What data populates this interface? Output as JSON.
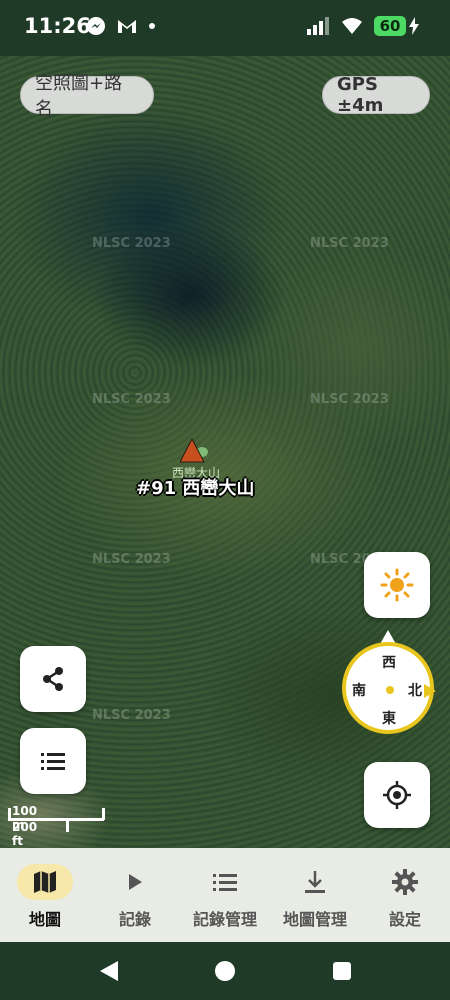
{
  "status_bar": {
    "time": "11:26",
    "battery": "60",
    "icons_left": [
      "messenger-icon",
      "gmail-icon",
      "dot-icon"
    ],
    "icons_right": [
      "signal-icon",
      "wifi-icon",
      "battery-icon",
      "charging-icon"
    ]
  },
  "map": {
    "layer_button": "空照圖+路名",
    "gps_accuracy": "GPS ±4m",
    "watermark": "NLSC 2023",
    "peak_label_small": "西巒大山",
    "peak_label": "#91 西巒大山",
    "compass": {
      "top": "西",
      "left": "南",
      "right": "北",
      "bottom": "東"
    },
    "scale": {
      "metric": "100 m",
      "imperial": "200 ft"
    }
  },
  "bottom_nav": [
    {
      "label": "地圖",
      "icon": "map-icon",
      "active": true
    },
    {
      "label": "記錄",
      "icon": "play-icon",
      "active": false
    },
    {
      "label": "記錄管理",
      "icon": "list-icon",
      "active": false
    },
    {
      "label": "地圖管理",
      "icon": "download-icon",
      "active": false
    },
    {
      "label": "設定",
      "icon": "gear-icon",
      "active": false
    }
  ],
  "colors": {
    "accent_yellow": "#e8c61e",
    "active_nav_bg": "#f7e7a8",
    "peak_marker": "#c8501e"
  }
}
